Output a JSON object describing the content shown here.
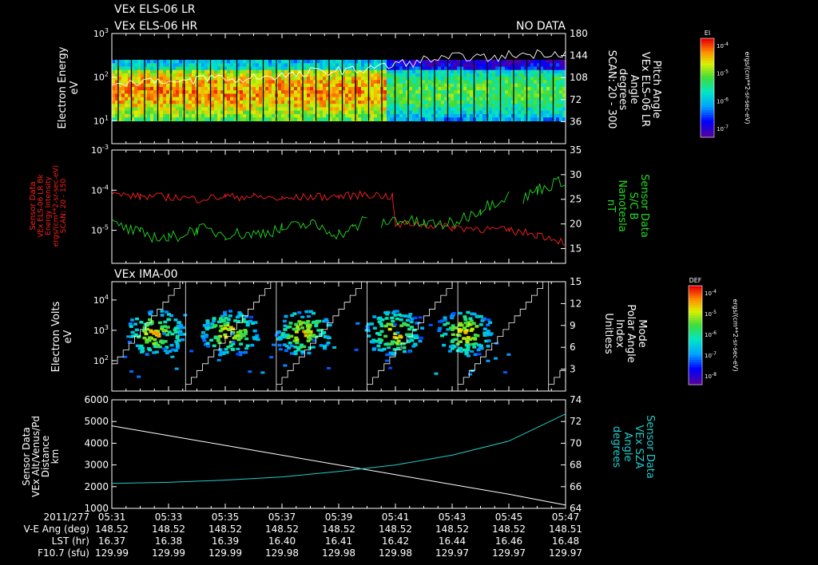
{
  "header": {
    "line1": "VEx ELS-06 LR",
    "line2": "VEx ELS-06 HR",
    "nodata": "NO DATA"
  },
  "colors": {
    "red": "#ff2020",
    "green": "#22dd22",
    "cyan": "#22cccc",
    "white": "#ffffff"
  },
  "time": {
    "date": "2011/277",
    "ticks": [
      "05:31",
      "05:33",
      "05:35",
      "05:37",
      "05:39",
      "05:41",
      "05:43",
      "05:45",
      "05:47"
    ],
    "rows": [
      {
        "label": "V-E Ang (deg)",
        "values": [
          "148.52",
          "148.52",
          "148.52",
          "148.52",
          "148.52",
          "148.52",
          "148.52",
          "148.52",
          "148.51"
        ]
      },
      {
        "label": "LST (hr)",
        "values": [
          "16.37",
          "16.38",
          "16.39",
          "16.40",
          "16.41",
          "16.42",
          "16.44",
          "16.46",
          "16.48"
        ]
      },
      {
        "label": "F10.7 (sfu)",
        "values": [
          "129.99",
          "129.99",
          "129.99",
          "129.98",
          "129.98",
          "129.98",
          "129.97",
          "129.97",
          "129.97"
        ]
      }
    ]
  },
  "chart_data": [
    {
      "type": "heatmap",
      "title": "",
      "ylabel": [
        "Electron Energy",
        "eV"
      ],
      "yticks": [
        "10^1",
        "10^2",
        "10^3"
      ],
      "ylim": [
        3,
        1000
      ],
      "yscale": "log",
      "y2label": [
        "Pitch Angle",
        "VEx ELS-06 LR",
        "Angle",
        "degrees",
        "SCAN: 20 - 300"
      ],
      "y2ticks": [
        36,
        72,
        108,
        144,
        180
      ],
      "y2lim": [
        0,
        180
      ],
      "colorbar": {
        "label": "EI",
        "unit": "ergs/(cm**2-sr-sec-eV)",
        "ticks": [
          "10^-4",
          "10^-5",
          "10^-6",
          "10^-7"
        ]
      },
      "energy_band_eV": [
        10,
        250
      ],
      "pitch_angle_series": [
        [
          0,
          100
        ],
        [
          1,
          104
        ],
        [
          2,
          100
        ],
        [
          3,
          108
        ],
        [
          4,
          104
        ],
        [
          5,
          110
        ],
        [
          6,
          112
        ],
        [
          7,
          118
        ],
        [
          8,
          120
        ],
        [
          9,
          126
        ],
        [
          10,
          132
        ],
        [
          11,
          138
        ],
        [
          12,
          142
        ],
        [
          13,
          140
        ],
        [
          14,
          146
        ],
        [
          15,
          148
        ],
        [
          16,
          150
        ]
      ]
    },
    {
      "type": "line",
      "title": "",
      "ylabel": [
        "Sensor Data",
        "VEx ELS-06 LR Bk",
        "Energy Intensity",
        "ergs/(cm**2-sr-sec-eV)",
        "SCAN: 20 - 150"
      ],
      "yticks": [
        "10^-5",
        "10^-4",
        "10^-3"
      ],
      "yscale": "log",
      "ylim": [
        1.5e-06,
        0.001
      ],
      "y2label": [
        "Sensor Data",
        "S/C B",
        "Nanotesla",
        "nT"
      ],
      "y2ticks": [
        15,
        20,
        25,
        30,
        35
      ],
      "y2lim": [
        12,
        35
      ],
      "series": [
        {
          "color": "red",
          "axis": "left",
          "x": [
            0,
            1,
            2,
            3,
            4,
            5,
            6,
            7,
            8,
            9,
            9.9,
            10,
            10.5,
            11,
            12,
            13,
            14,
            15,
            16
          ],
          "values": [
            8e-05,
            7e-05,
            7e-05,
            6e-05,
            7e-05,
            7e-05,
            6e-05,
            7e-05,
            7e-05,
            8e-05,
            7e-05,
            1.3e-05,
            1.5e-05,
            1.4e-05,
            1.2e-05,
            1.1e-05,
            1e-05,
            8e-06,
            5e-06
          ]
        },
        {
          "color": "green",
          "axis": "right",
          "x": [
            0,
            1,
            2,
            3,
            4,
            5,
            6,
            7,
            8,
            8.5,
            9,
            9.5,
            10,
            11,
            12,
            13,
            14,
            14.5,
            15,
            16
          ],
          "values": [
            20,
            18,
            17,
            19,
            18,
            18,
            19,
            20,
            18,
            19,
            21,
            20,
            21,
            20,
            20,
            23,
            26,
            25,
            27,
            29
          ]
        }
      ]
    },
    {
      "type": "heatmap",
      "title": "VEx IMA-00",
      "ylabel": [
        "Electron Volts",
        "eV"
      ],
      "yticks": [
        "10^2",
        "10^3",
        "10^4"
      ],
      "yscale": "log",
      "ylim": [
        10,
        40000
      ],
      "y2label": [
        "Mode",
        "Polar Angle",
        "Index",
        "Unitless"
      ],
      "y2ticks": [
        3,
        6,
        9,
        12,
        15
      ],
      "y2lim": [
        0,
        15
      ],
      "colorbar": {
        "label": "DEF",
        "unit": "ergs/(cm**2-sr-sec-eV)",
        "ticks": [
          "10^-4",
          "10^-5",
          "10^-6",
          "10^-7",
          "10^-8"
        ]
      },
      "scan_clusters_min": [
        0.6,
        3.2,
        5.8,
        9.0,
        11.5
      ]
    },
    {
      "type": "line",
      "title": "",
      "ylabel": [
        "Sensor Data",
        "VEx Alt/Venus/Pd",
        "Distance",
        "km"
      ],
      "yticks": [
        1000,
        2000,
        3000,
        4000,
        5000,
        6000
      ],
      "ylim": [
        1000,
        6000
      ],
      "y2label": [
        "Sensor Data",
        "VEx SZA",
        "Angle",
        "degrees"
      ],
      "y2ticks": [
        64,
        66,
        68,
        70,
        72,
        74
      ],
      "y2lim": [
        64,
        74
      ],
      "series": [
        {
          "color": "white",
          "axis": "left",
          "x": [
            0,
            2,
            4,
            6,
            8,
            10,
            12,
            14,
            16
          ],
          "values": [
            4800,
            4350,
            3900,
            3450,
            3000,
            2550,
            2100,
            1650,
            1150
          ]
        },
        {
          "color": "cyan",
          "axis": "right",
          "x": [
            0,
            2,
            4,
            6,
            8,
            10,
            12,
            14,
            16
          ],
          "values": [
            66.3,
            66.4,
            66.6,
            66.9,
            67.4,
            68.0,
            68.9,
            70.2,
            72.7
          ]
        }
      ]
    }
  ]
}
